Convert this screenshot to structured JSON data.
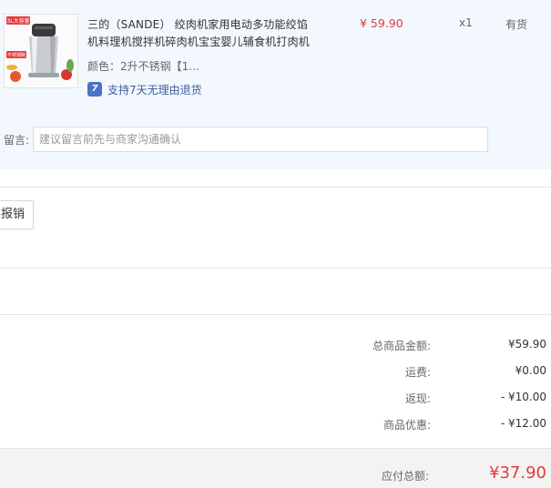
{
  "product": {
    "thumbnail_badge": "3L大容量",
    "thumbnail_tag": "不锈钢碗",
    "title_line1": "三的（SANDE） 绞肉机家用电动多功能绞馅",
    "title_line2": "机料理机搅拌机碎肉机宝宝婴儿辅食机打肉机",
    "price": "¥ 59.90",
    "quantity": "x1",
    "stock_status": "有货",
    "variant": "颜色：2升不锈钢【1...",
    "return_badge_icon": "7",
    "return_policy": "支持7天无理由退货"
  },
  "remark": {
    "label": "留言:",
    "placeholder": "建议留言前先与商家沟通确认",
    "value": ""
  },
  "invoice": {
    "button_label": "报销"
  },
  "summary": {
    "rows": [
      {
        "label": "总商品金额:",
        "value": "¥59.90"
      },
      {
        "label": "运费:",
        "value": "¥0.00"
      },
      {
        "label": "返现:",
        "value": "- ¥10.00"
      },
      {
        "label": "商品优惠:",
        "value": "- ¥12.00"
      }
    ],
    "total_label": "应付总额:",
    "total_value": "¥37.90"
  },
  "colors": {
    "accent_red": "#e4393c",
    "panel_bg": "#f2f8fd",
    "return_blue": "#4a72c6"
  }
}
